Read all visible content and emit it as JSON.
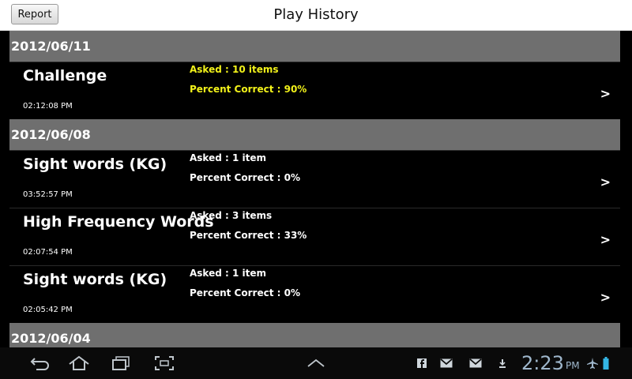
{
  "header": {
    "report_label": "Report",
    "title": "Play History"
  },
  "groups": [
    {
      "date": "2012/06/11",
      "items": [
        {
          "title": "Challenge",
          "time": "02:12:08 PM",
          "asked": "Asked : 10 items",
          "percent": "Percent Correct : 90%",
          "highlight": true
        }
      ]
    },
    {
      "date": "2012/06/08",
      "items": [
        {
          "title": "Sight words (KG)",
          "time": "03:52:57 PM",
          "asked": "Asked : 1 item",
          "percent": "Percent Correct : 0%",
          "highlight": false
        },
        {
          "title": "High Frequency Words",
          "time": "02:07:54 PM",
          "asked": "Asked : 3 items",
          "percent": "Percent Correct : 33%",
          "highlight": false
        },
        {
          "title": "Sight words (KG)",
          "time": "02:05:42 PM",
          "asked": "Asked : 1 item",
          "percent": "Percent Correct : 0%",
          "highlight": false
        }
      ]
    },
    {
      "date": "2012/06/04",
      "items": []
    }
  ],
  "row_arrow": ">",
  "statusbar": {
    "time": "2:23",
    "ampm": "PM"
  },
  "icons": {
    "back": "back-icon",
    "home": "home-icon",
    "recent": "recent-apps-icon",
    "screenshot": "screenshot-icon",
    "menu": "chevron-up-icon"
  },
  "colors": {
    "highlight_text": "#f2f21a",
    "date_header_bg": "#6f6f6f",
    "clock": "#9fb7cc"
  }
}
